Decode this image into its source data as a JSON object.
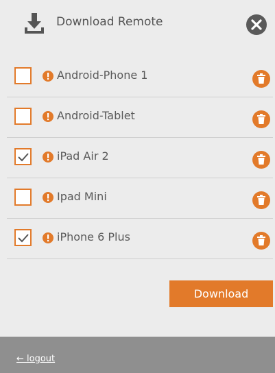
{
  "header": {
    "title": "Download Remote",
    "download_icon": "download-icon",
    "close_icon": "close-icon"
  },
  "devices": [
    {
      "name": "Android-Phone 1",
      "checked": false
    },
    {
      "name": "Android-Tablet",
      "checked": false
    },
    {
      "name": "iPad Air 2",
      "checked": true
    },
    {
      "name": "Ipad Mini",
      "checked": false
    },
    {
      "name": "iPhone 6 Plus",
      "checked": true
    }
  ],
  "row_icons": {
    "warning": "warning-icon",
    "delete": "trash-icon",
    "check": "check-icon"
  },
  "actions": {
    "download_label": "Download"
  },
  "footer": {
    "logout_label": "← logout"
  },
  "colors": {
    "accent": "#e27a2a",
    "background": "#ececec",
    "footer": "#8f8f8f",
    "text": "#555555"
  }
}
